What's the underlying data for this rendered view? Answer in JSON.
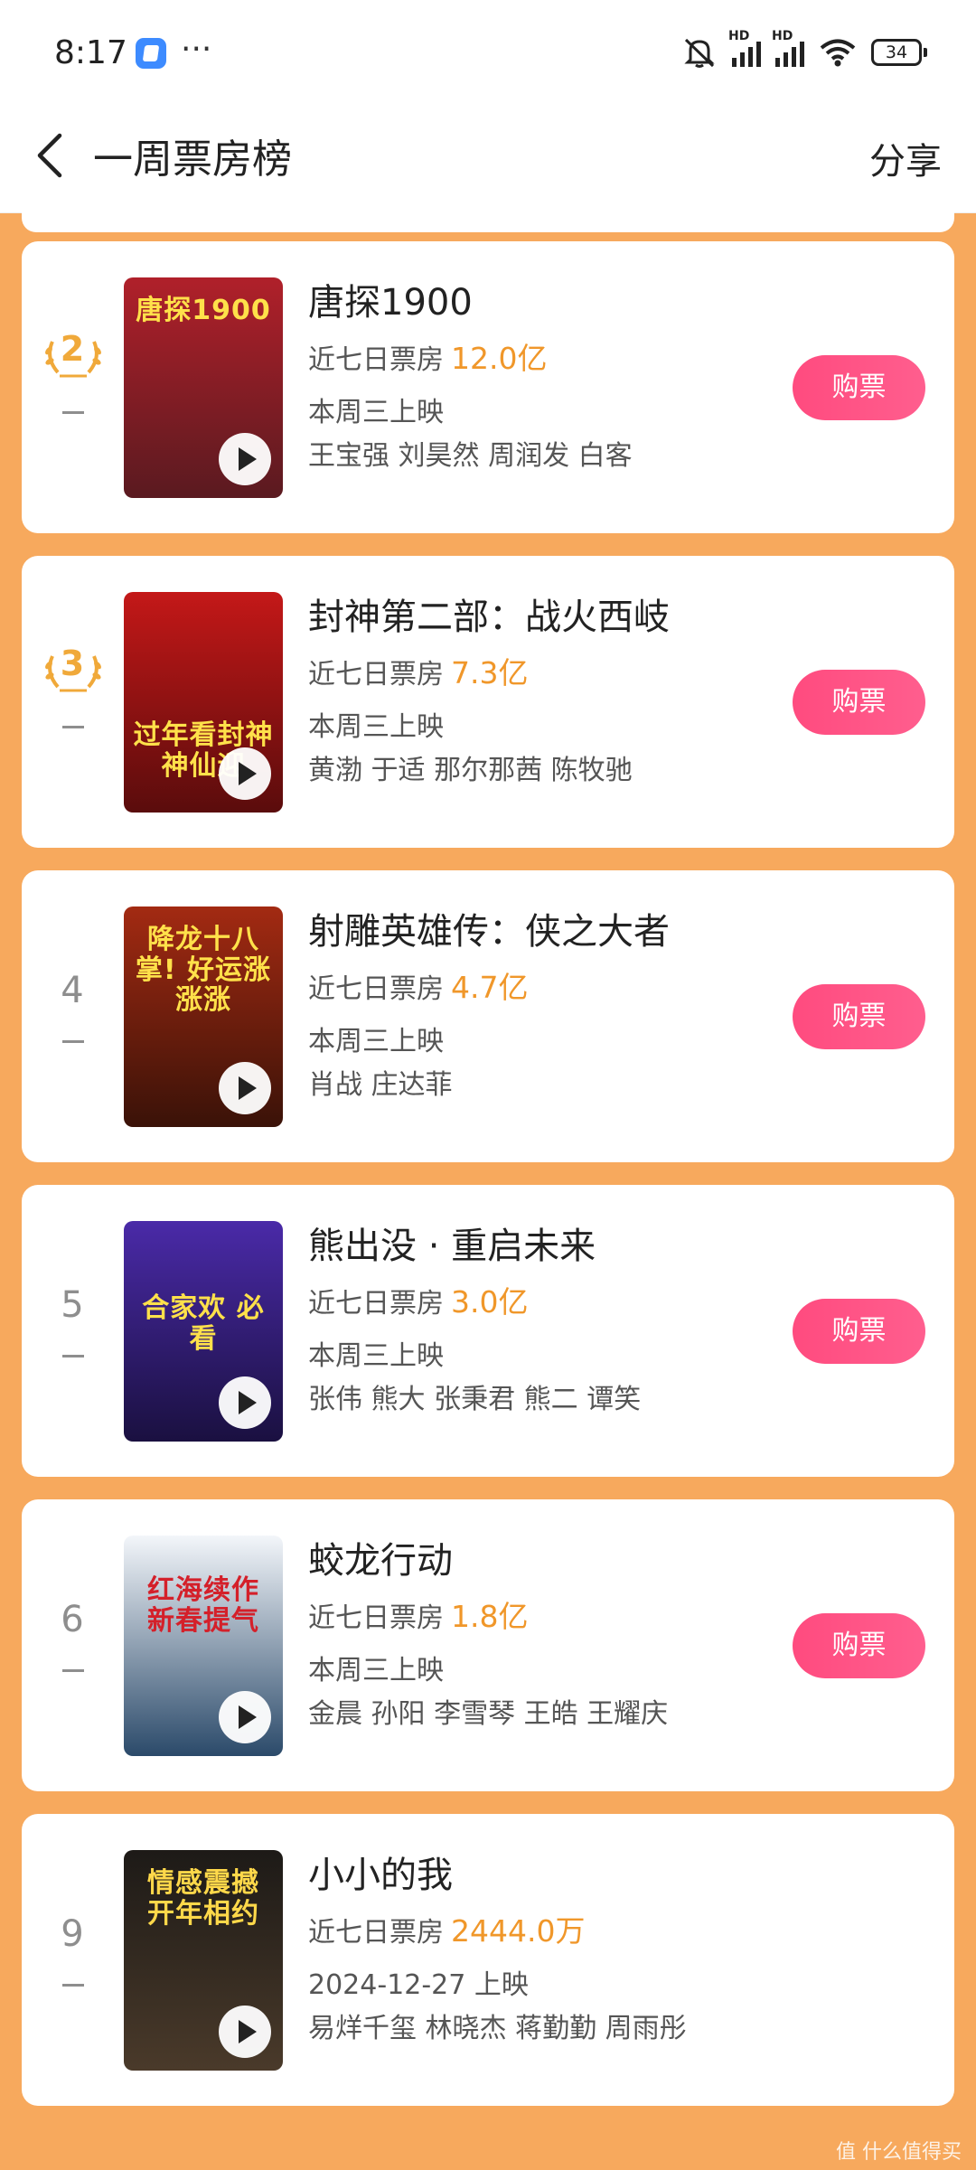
{
  "status_bar": {
    "time": "8:17",
    "battery": "34",
    "signal_label": "HD"
  },
  "header": {
    "title": "一周票房榜",
    "share_label": "分享"
  },
  "movies": [
    {
      "rank": "2",
      "rank_style": "laurel",
      "rank_change": "-",
      "title": "唐探1900",
      "box_label": "近七日票房",
      "box_value": "12.0亿",
      "release": "本周三上映",
      "cast": "王宝强 刘昊然 周润发 白客",
      "buy_label": "购票",
      "poster_colors": [
        "#b0202a",
        "#5a1a20"
      ],
      "poster_text": "唐探1900"
    },
    {
      "rank": "3",
      "rank_style": "laurel",
      "rank_change": "-",
      "title": "封神第二部：战火西岐",
      "box_label": "近七日票房",
      "box_value": "7.3亿",
      "release": "本周三上映",
      "cast": "黄渤 于适 那尔那茜 陈牧驰",
      "buy_label": "购票",
      "poster_colors": [
        "#c41818",
        "#5a0c0c"
      ],
      "poster_text": "过年看封神 神仙迎"
    },
    {
      "rank": "4",
      "rank_style": "plain",
      "rank_change": "-",
      "title": "射雕英雄传：侠之大者",
      "box_label": "近七日票房",
      "box_value": "4.7亿",
      "release": "本周三上映",
      "cast": "肖战 庄达菲",
      "buy_label": "购票",
      "poster_colors": [
        "#a32a12",
        "#3a1208"
      ],
      "poster_text": "降龙十八掌! 好运涨涨涨"
    },
    {
      "rank": "5",
      "rank_style": "plain",
      "rank_change": "-",
      "title": "熊出没 · 重启未来",
      "box_label": "近七日票房",
      "box_value": "3.0亿",
      "release": "本周三上映",
      "cast": "张伟 熊大 张秉君 熊二 谭笑",
      "buy_label": "购票",
      "poster_colors": [
        "#4a2aa8",
        "#1a1040"
      ],
      "poster_text": "合家欢 必看"
    },
    {
      "rank": "6",
      "rank_style": "plain",
      "rank_change": "-",
      "title": "蛟龙行动",
      "box_label": "近七日票房",
      "box_value": "1.8亿",
      "release": "本周三上映",
      "cast": "金晨 孙阳 李雪琴 王皓 王耀庆",
      "buy_label": "购票",
      "poster_colors": [
        "#f3f6fa",
        "#2b4a6a"
      ],
      "poster_text": "红海续作 新春提气"
    },
    {
      "rank": "9",
      "rank_style": "plain",
      "rank_change": "-",
      "title": "小小的我",
      "box_label": "近七日票房",
      "box_value": "2444.0万",
      "release": "2024-12-27 上映",
      "cast": "易烊千玺 林晓杰 蒋勤勤 周雨彤",
      "buy_label": "",
      "poster_colors": [
        "#1d1a17",
        "#4a3a2a"
      ],
      "poster_text": "情感震撼 开年相约"
    }
  ],
  "watermark": "值 什么值得买"
}
